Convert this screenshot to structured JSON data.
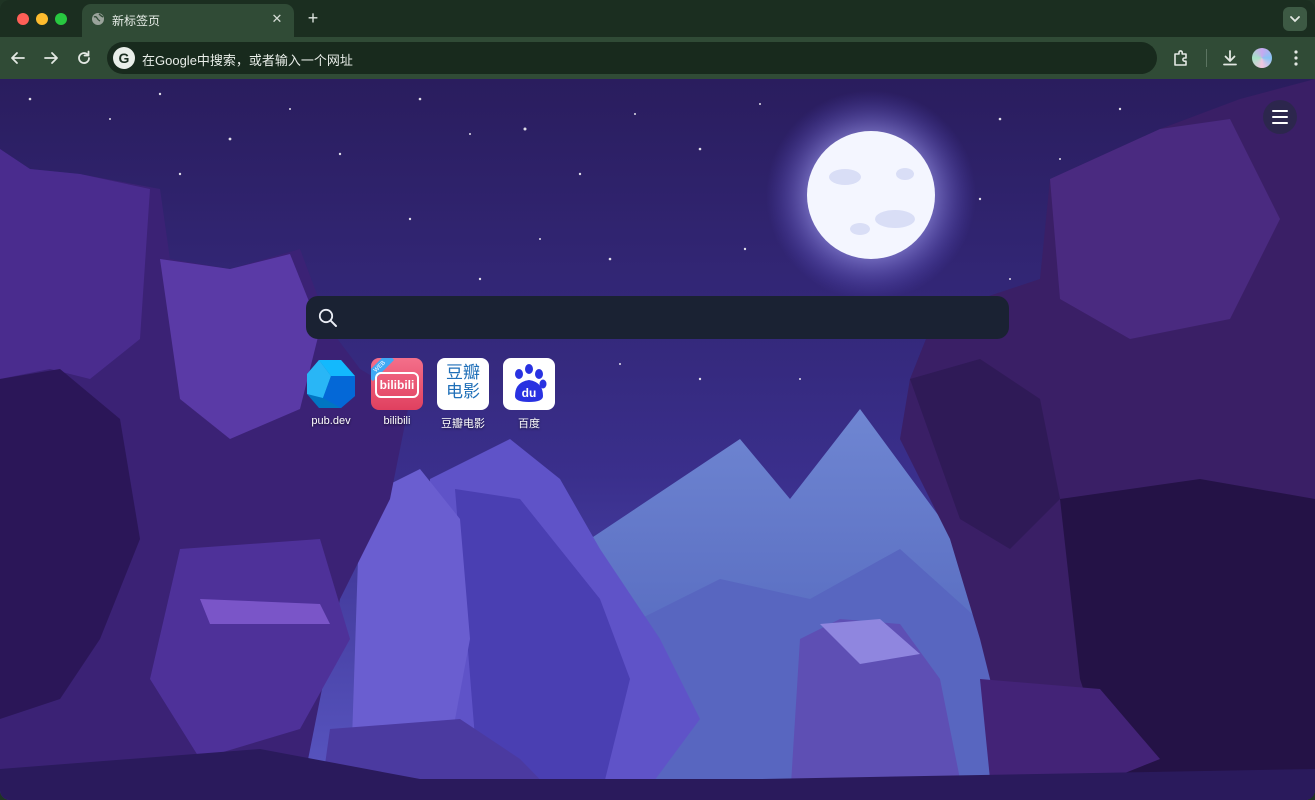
{
  "window": {
    "traffic_lights": [
      "close",
      "minimize",
      "zoom"
    ]
  },
  "tab": {
    "title": "新标签页",
    "close_symbol": "✕",
    "favicon": "globe-icon"
  },
  "new_tab_symbol": "+",
  "toolbar": {
    "back_icon": "arrow-left-icon",
    "forward_icon": "arrow-right-icon",
    "reload_icon": "reload-icon",
    "omnibox_badge": "G",
    "omnibox_placeholder": "在Google中搜索，或者输入一个网址",
    "extensions_icon": "puzzle-icon",
    "download_icon": "download-icon",
    "more_icon": "kebab-menu-icon"
  },
  "newtab": {
    "menu_icon": "hamburger-icon",
    "search_icon": "search-icon",
    "shortcuts": [
      {
        "label": "pub.dev",
        "icon": "dart-logo"
      },
      {
        "label": "bilibili",
        "icon": "bilibili-logo",
        "icon_text": "bilibili",
        "ribbon": "WEB"
      },
      {
        "label": "豆瓣电影",
        "icon": "douban-movie-logo",
        "icon_text_top": "豆瓣",
        "icon_text_bottom": "电影"
      },
      {
        "label": "百度",
        "icon": "baidu-logo",
        "icon_text": "du"
      }
    ]
  },
  "colors": {
    "tabstrip": "#1b2e20",
    "toolbar": "#304b36",
    "sky_top": "#2a1d5e",
    "sky_bottom": "#5a58c4",
    "moon": "#f4f6ff",
    "searchbox": "#1a2233",
    "bilibili_pink": "#f0526f",
    "douban_blue": "#1f6fb8",
    "baidu_blue": "#2932e1"
  }
}
